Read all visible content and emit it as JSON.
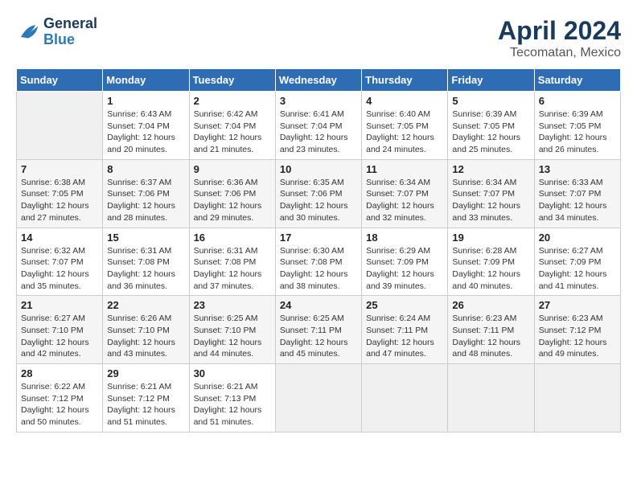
{
  "logo": {
    "line1": "General",
    "line2": "Blue"
  },
  "title": "April 2024",
  "subtitle": "Tecomatan, Mexico",
  "days_header": [
    "Sunday",
    "Monday",
    "Tuesday",
    "Wednesday",
    "Thursday",
    "Friday",
    "Saturday"
  ],
  "weeks": [
    [
      {
        "day": "",
        "info": ""
      },
      {
        "day": "1",
        "info": "Sunrise: 6:43 AM\nSunset: 7:04 PM\nDaylight: 12 hours\nand 20 minutes."
      },
      {
        "day": "2",
        "info": "Sunrise: 6:42 AM\nSunset: 7:04 PM\nDaylight: 12 hours\nand 21 minutes."
      },
      {
        "day": "3",
        "info": "Sunrise: 6:41 AM\nSunset: 7:04 PM\nDaylight: 12 hours\nand 23 minutes."
      },
      {
        "day": "4",
        "info": "Sunrise: 6:40 AM\nSunset: 7:05 PM\nDaylight: 12 hours\nand 24 minutes."
      },
      {
        "day": "5",
        "info": "Sunrise: 6:39 AM\nSunset: 7:05 PM\nDaylight: 12 hours\nand 25 minutes."
      },
      {
        "day": "6",
        "info": "Sunrise: 6:39 AM\nSunset: 7:05 PM\nDaylight: 12 hours\nand 26 minutes."
      }
    ],
    [
      {
        "day": "7",
        "info": "Sunrise: 6:38 AM\nSunset: 7:05 PM\nDaylight: 12 hours\nand 27 minutes."
      },
      {
        "day": "8",
        "info": "Sunrise: 6:37 AM\nSunset: 7:06 PM\nDaylight: 12 hours\nand 28 minutes."
      },
      {
        "day": "9",
        "info": "Sunrise: 6:36 AM\nSunset: 7:06 PM\nDaylight: 12 hours\nand 29 minutes."
      },
      {
        "day": "10",
        "info": "Sunrise: 6:35 AM\nSunset: 7:06 PM\nDaylight: 12 hours\nand 30 minutes."
      },
      {
        "day": "11",
        "info": "Sunrise: 6:34 AM\nSunset: 7:07 PM\nDaylight: 12 hours\nand 32 minutes."
      },
      {
        "day": "12",
        "info": "Sunrise: 6:34 AM\nSunset: 7:07 PM\nDaylight: 12 hours\nand 33 minutes."
      },
      {
        "day": "13",
        "info": "Sunrise: 6:33 AM\nSunset: 7:07 PM\nDaylight: 12 hours\nand 34 minutes."
      }
    ],
    [
      {
        "day": "14",
        "info": "Sunrise: 6:32 AM\nSunset: 7:07 PM\nDaylight: 12 hours\nand 35 minutes."
      },
      {
        "day": "15",
        "info": "Sunrise: 6:31 AM\nSunset: 7:08 PM\nDaylight: 12 hours\nand 36 minutes."
      },
      {
        "day": "16",
        "info": "Sunrise: 6:31 AM\nSunset: 7:08 PM\nDaylight: 12 hours\nand 37 minutes."
      },
      {
        "day": "17",
        "info": "Sunrise: 6:30 AM\nSunset: 7:08 PM\nDaylight: 12 hours\nand 38 minutes."
      },
      {
        "day": "18",
        "info": "Sunrise: 6:29 AM\nSunset: 7:09 PM\nDaylight: 12 hours\nand 39 minutes."
      },
      {
        "day": "19",
        "info": "Sunrise: 6:28 AM\nSunset: 7:09 PM\nDaylight: 12 hours\nand 40 minutes."
      },
      {
        "day": "20",
        "info": "Sunrise: 6:27 AM\nSunset: 7:09 PM\nDaylight: 12 hours\nand 41 minutes."
      }
    ],
    [
      {
        "day": "21",
        "info": "Sunrise: 6:27 AM\nSunset: 7:10 PM\nDaylight: 12 hours\nand 42 minutes."
      },
      {
        "day": "22",
        "info": "Sunrise: 6:26 AM\nSunset: 7:10 PM\nDaylight: 12 hours\nand 43 minutes."
      },
      {
        "day": "23",
        "info": "Sunrise: 6:25 AM\nSunset: 7:10 PM\nDaylight: 12 hours\nand 44 minutes."
      },
      {
        "day": "24",
        "info": "Sunrise: 6:25 AM\nSunset: 7:11 PM\nDaylight: 12 hours\nand 45 minutes."
      },
      {
        "day": "25",
        "info": "Sunrise: 6:24 AM\nSunset: 7:11 PM\nDaylight: 12 hours\nand 47 minutes."
      },
      {
        "day": "26",
        "info": "Sunrise: 6:23 AM\nSunset: 7:11 PM\nDaylight: 12 hours\nand 48 minutes."
      },
      {
        "day": "27",
        "info": "Sunrise: 6:23 AM\nSunset: 7:12 PM\nDaylight: 12 hours\nand 49 minutes."
      }
    ],
    [
      {
        "day": "28",
        "info": "Sunrise: 6:22 AM\nSunset: 7:12 PM\nDaylight: 12 hours\nand 50 minutes."
      },
      {
        "day": "29",
        "info": "Sunrise: 6:21 AM\nSunset: 7:12 PM\nDaylight: 12 hours\nand 51 minutes."
      },
      {
        "day": "30",
        "info": "Sunrise: 6:21 AM\nSunset: 7:13 PM\nDaylight: 12 hours\nand 51 minutes."
      },
      {
        "day": "",
        "info": ""
      },
      {
        "day": "",
        "info": ""
      },
      {
        "day": "",
        "info": ""
      },
      {
        "day": "",
        "info": ""
      }
    ]
  ]
}
